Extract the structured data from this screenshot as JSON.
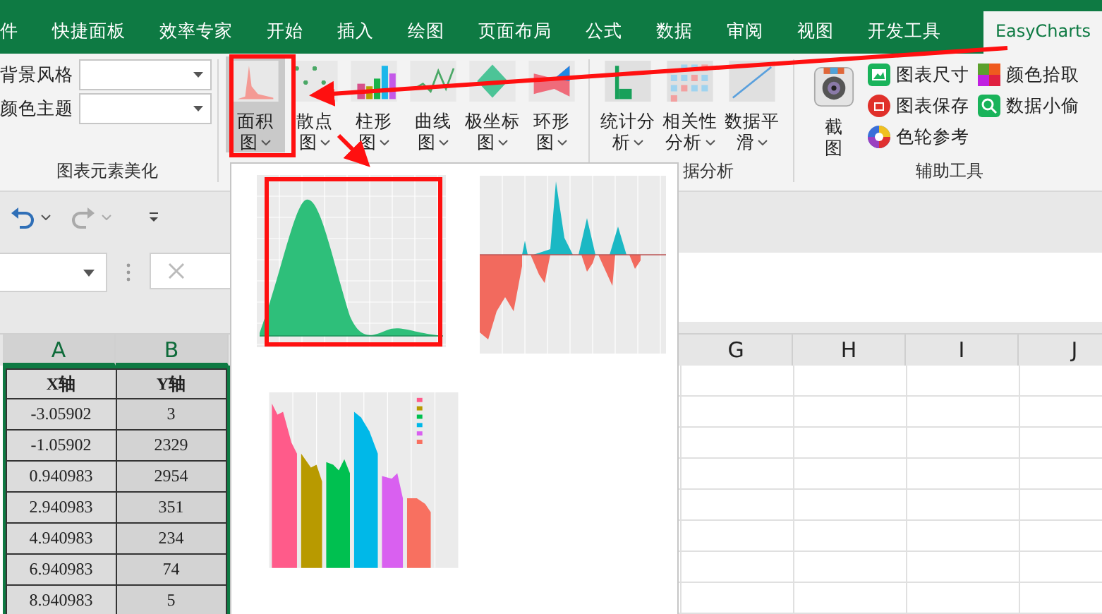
{
  "tabs": [
    {
      "label": "件",
      "selected": false
    },
    {
      "label": "快捷面板",
      "selected": false
    },
    {
      "label": "效率专家",
      "selected": false
    },
    {
      "label": "开始",
      "selected": false
    },
    {
      "label": "插入",
      "selected": false
    },
    {
      "label": "绘图",
      "selected": false
    },
    {
      "label": "页面布局",
      "selected": false
    },
    {
      "label": "公式",
      "selected": false
    },
    {
      "label": "数据",
      "selected": false
    },
    {
      "label": "审阅",
      "selected": false
    },
    {
      "label": "视图",
      "selected": false
    },
    {
      "label": "开发工具",
      "selected": false
    },
    {
      "label": "EasyCharts",
      "selected": true
    }
  ],
  "style_group": {
    "fields": [
      {
        "label": "背景风格"
      },
      {
        "label": "颜色主题"
      }
    ],
    "title": "图表元素美化"
  },
  "chart_group": {
    "buttons": [
      {
        "lines": [
          "面积",
          "图"
        ],
        "selected": true
      },
      {
        "lines": [
          "散点",
          "图"
        ],
        "selected": false
      },
      {
        "lines": [
          "柱形",
          "图"
        ],
        "selected": false
      },
      {
        "lines": [
          "曲线",
          "图"
        ],
        "selected": false
      },
      {
        "lines": [
          "极坐标",
          "图"
        ],
        "selected": false
      },
      {
        "lines": [
          "环形",
          "图"
        ],
        "selected": false
      }
    ]
  },
  "analysis_group": {
    "buttons": [
      {
        "lines": [
          "统计分",
          "析"
        ]
      },
      {
        "lines": [
          "相关性",
          "分析"
        ]
      },
      {
        "lines": [
          "数据平",
          "滑"
        ]
      }
    ],
    "title": "据分析"
  },
  "tools_group": {
    "screenshot": {
      "lines": [
        "截",
        "图"
      ]
    },
    "items": [
      {
        "label": "图表尺寸"
      },
      {
        "label": "图表保存"
      },
      {
        "label": "色轮参考"
      },
      {
        "label": "颜色拾取"
      },
      {
        "label": "数据小偷"
      }
    ],
    "title": "辅助工具"
  },
  "sheet": {
    "columns": [
      {
        "label": "A",
        "selected": true
      },
      {
        "label": "B",
        "selected": true
      },
      {
        "label": "G",
        "selected": false
      },
      {
        "label": "H",
        "selected": false
      },
      {
        "label": "I",
        "selected": false
      },
      {
        "label": "J",
        "selected": false
      }
    ],
    "rows": [
      [
        "X轴",
        "Y轴"
      ],
      [
        "-3.05902",
        "3"
      ],
      [
        "-1.05902",
        "2329"
      ],
      [
        "0.940983",
        "2954"
      ],
      [
        "2.940983",
        "351"
      ],
      [
        "4.940983",
        "234"
      ],
      [
        "6.940983",
        "74"
      ],
      [
        "8.940983",
        "5"
      ]
    ]
  }
}
